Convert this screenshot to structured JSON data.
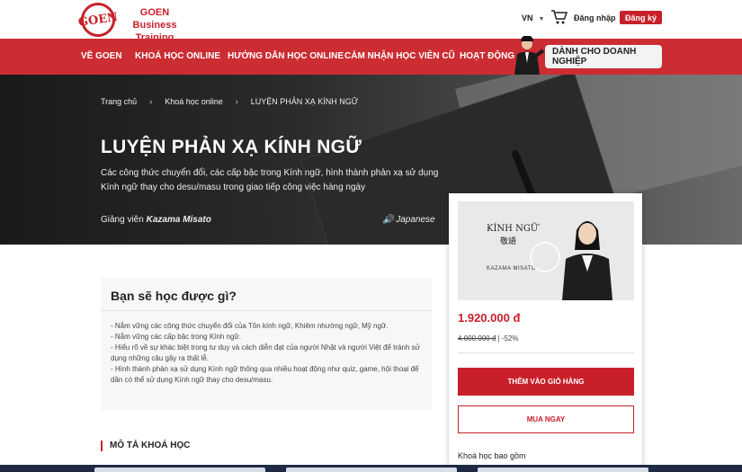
{
  "header": {
    "logo_text": "GOEN",
    "brand": "GOEN Business Training",
    "language": "VN",
    "login": "Đăng nhập",
    "register": "Đăng ký"
  },
  "nav": {
    "items": [
      "VỀ GOEN",
      "KHOÁ HỌC ONLINE",
      "HƯỚNG DẪN HỌC ONLINE",
      "CẢM NHẬN HỌC VIÊN CŨ",
      "HOẠT ĐỘNG"
    ],
    "business": "DÀNH CHO DOANH NGHIỆP"
  },
  "breadcrumb": [
    "Trang chủ",
    "Khoá học online",
    "LUYỆN PHẢN XẠ KÍNH NGỮ"
  ],
  "course": {
    "title": "LUYỆN PHẢN XẠ KÍNH NGỮ",
    "description": "Các công thức chuyển đổi, các cấp bậc trong Kính ngữ, hình thành phản xạ sử dụng Kính ngữ thay cho desu/masu trong giao tiếp công việc hàng ngày",
    "lecturer_label": "Giảng viên",
    "lecturer_name": "Kazama Misato",
    "language": "Japanese"
  },
  "card": {
    "thumb_title": "KÍNH NGỮ",
    "thumb_kanji": "敬語",
    "thumb_name": "KAZAMA MISATO",
    "price": "1.920.000 đ",
    "old_price": "4.000.000 đ",
    "discount": "| -52%",
    "add_to_cart": "THÊM VÀO GIỎ HÀNG",
    "buy_now": "MUA NGAY",
    "includes": "Khoá học bao gồm"
  },
  "learn": {
    "heading": "Bạn sẽ học được gì?",
    "items": [
      "- Nắm vững các công thức chuyển đổi của Tôn kính ngữ, Khiêm nhường ngữ, Mỹ ngữ.",
      "- Nắm vững các cấp bậc trong Kính ngữ.",
      "- Hiểu rõ về sự khác biệt trong tư duy và cách diễn đạt của người Nhật và người Việt để tránh sử dụng những câu gây ra thất lễ.",
      "- Hình thành phản xạ sử dụng Kính ngữ thông qua nhiều hoạt động như quiz, game, hội thoại để dần có thể sử dụng Kính ngữ thay cho desu/masu."
    ]
  },
  "section": {
    "description_heading": "MÔ TẢ KHOÁ HỌC"
  },
  "colors": {
    "brand_red": "#c8202b",
    "nav_red": "#cb2d33"
  }
}
